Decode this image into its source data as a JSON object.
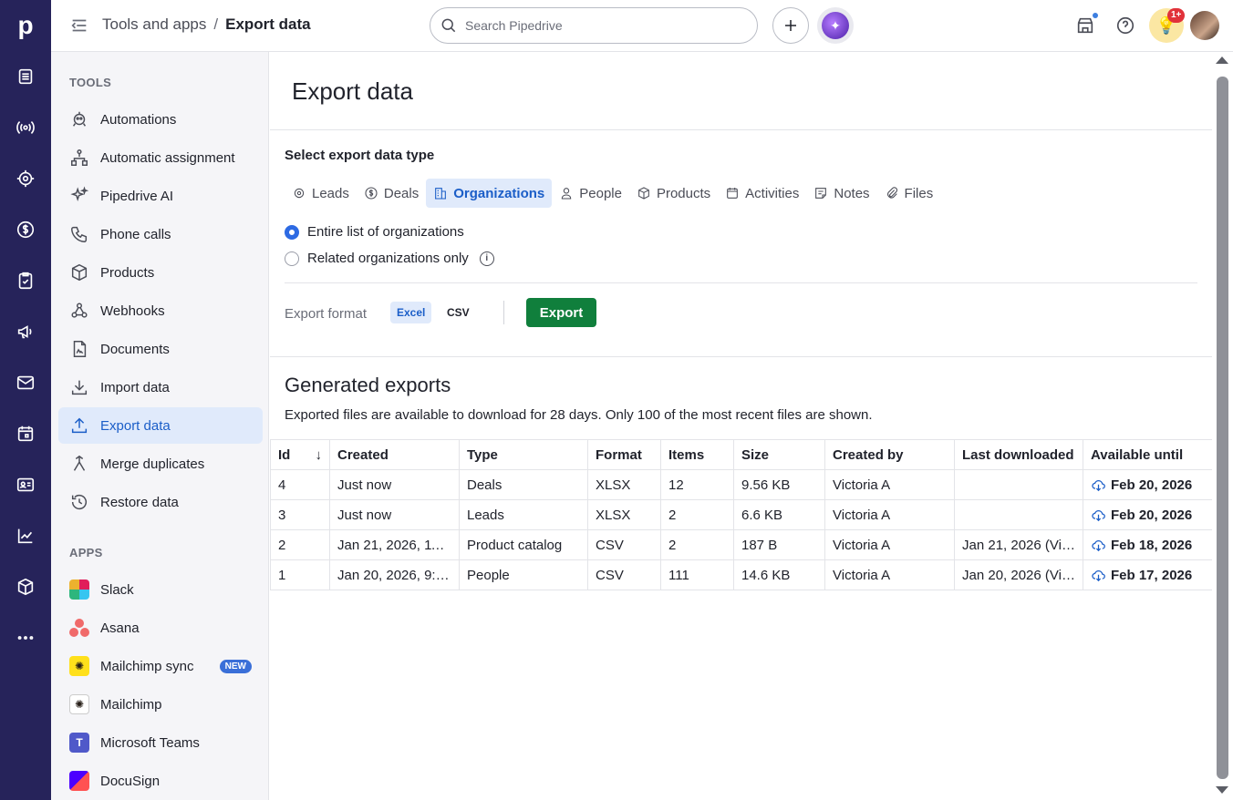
{
  "colors": {
    "rail": "#26235a",
    "accent": "#1b5ec8",
    "export_button": "#107f3c",
    "active_bg": "#e0eafb"
  },
  "rail": {
    "logo": "p"
  },
  "topbar": {
    "breadcrumb_parent": "Tools and apps",
    "breadcrumb_sep": "/",
    "breadcrumb_current": "Export data",
    "search_placeholder": "Search Pipedrive",
    "notifications_badge": "1+"
  },
  "sidebar": {
    "tools_heading": "TOOLS",
    "tools": [
      {
        "label": "Automations"
      },
      {
        "label": "Automatic assignment"
      },
      {
        "label": "Pipedrive AI"
      },
      {
        "label": "Phone calls"
      },
      {
        "label": "Products"
      },
      {
        "label": "Webhooks"
      },
      {
        "label": "Documents"
      },
      {
        "label": "Import data"
      },
      {
        "label": "Export data"
      },
      {
        "label": "Merge duplicates"
      },
      {
        "label": "Restore data"
      }
    ],
    "apps_heading": "APPS",
    "apps": [
      {
        "label": "Slack"
      },
      {
        "label": "Asana"
      },
      {
        "label": "Mailchimp sync",
        "badge": "NEW"
      },
      {
        "label": "Mailchimp"
      },
      {
        "label": "Microsoft Teams"
      },
      {
        "label": "DocuSign"
      }
    ]
  },
  "main": {
    "title": "Export data",
    "select_label": "Select export data type",
    "tabs": [
      {
        "label": "Leads"
      },
      {
        "label": "Deals"
      },
      {
        "label": "Organizations",
        "active": true
      },
      {
        "label": "People"
      },
      {
        "label": "Products"
      },
      {
        "label": "Activities"
      },
      {
        "label": "Notes"
      },
      {
        "label": "Files"
      }
    ],
    "radio_entire": "Entire list of organizations",
    "radio_related": "Related organizations only",
    "format_label": "Export format",
    "format_excel": "Excel",
    "format_csv": "CSV",
    "export_button": "Export",
    "generated_title": "Generated exports",
    "generated_desc": "Exported files are available to download for 28 days. Only 100 of the most recent files are shown.",
    "table": {
      "headers": [
        "Id",
        "Created",
        "Type",
        "Format",
        "Items",
        "Size",
        "Created by",
        "Last downloaded",
        "Available until"
      ],
      "rows": [
        [
          "4",
          "Just now",
          "Deals",
          "XLSX",
          "12",
          "9.56 KB",
          "Victoria A",
          "",
          "Feb 20, 2026"
        ],
        [
          "3",
          "Just now",
          "Leads",
          "XLSX",
          "2",
          "6.6 KB",
          "Victoria A",
          "",
          "Feb 20, 2026"
        ],
        [
          "2",
          "Jan 21, 2026, 11:…",
          "Product catalog",
          "CSV",
          "2",
          "187 B",
          "Victoria A",
          "Jan 21, 2026 (Vi…",
          "Feb 18, 2026"
        ],
        [
          "1",
          "Jan 20, 2026, 9:…",
          "People",
          "CSV",
          "111",
          "14.6 KB",
          "Victoria A",
          "Jan 20, 2026 (Vi…",
          "Feb 17, 2026"
        ]
      ]
    }
  }
}
